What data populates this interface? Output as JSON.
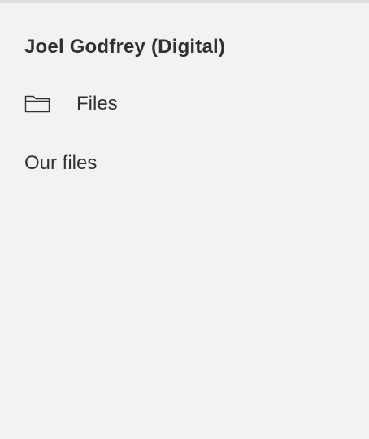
{
  "sidebar": {
    "heading": "Joel Godfrey (Digital)",
    "items": [
      {
        "label": "Files",
        "icon": "folder-icon"
      }
    ],
    "section_link": "Our files"
  },
  "colors": {
    "background": "#f3f2f1",
    "text": "#323130",
    "top_border": "#e1dfdd"
  }
}
